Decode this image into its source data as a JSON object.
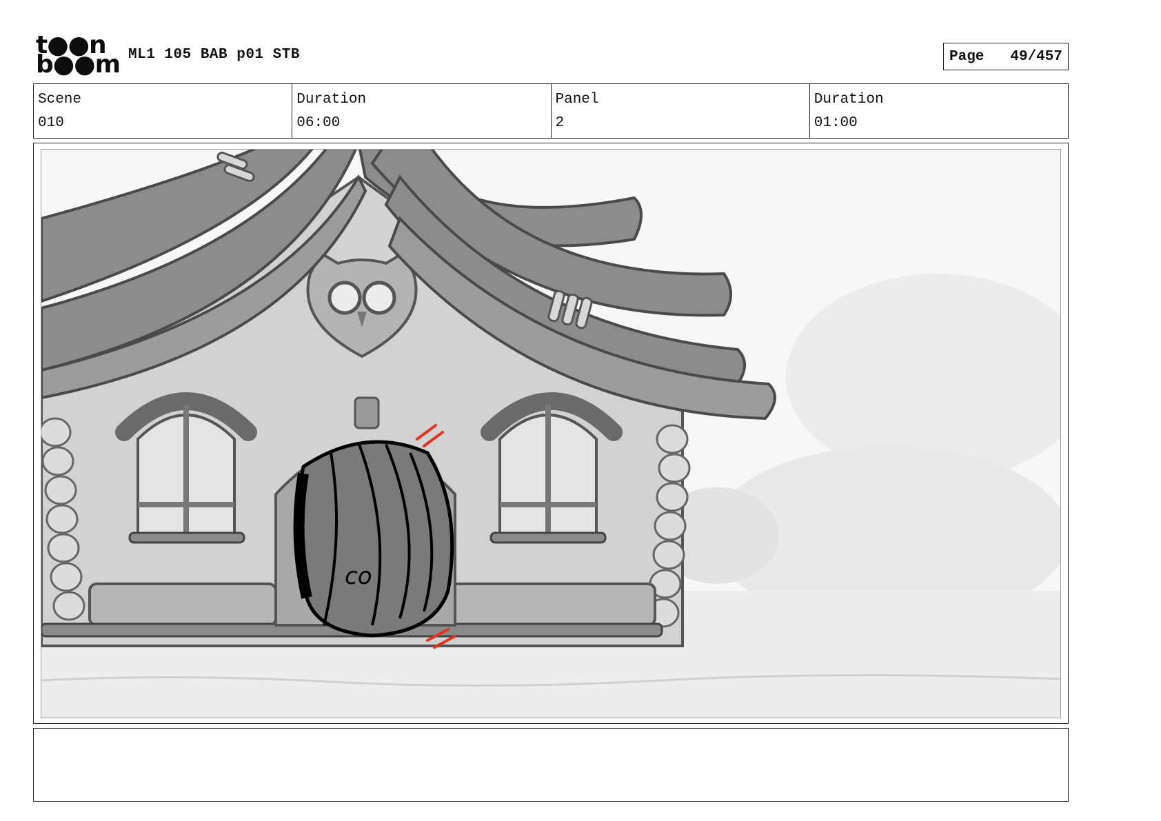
{
  "header": {
    "logo_top": "t●●n",
    "logo_bottom": "b●●m",
    "title": "ML1 105 BAB p01 STB",
    "page_label": "Page",
    "page_value": "49/457"
  },
  "info": {
    "scene_label": "Scene",
    "scene_value": "010",
    "scene_duration_label": "Duration",
    "scene_duration_value": "06:00",
    "panel_label": "Panel",
    "panel_value": "2",
    "panel_duration_label": "Duration",
    "panel_duration_value": "01:00"
  },
  "panel": {
    "door_mark": "co"
  },
  "notes": {
    "text": ""
  },
  "colors": {
    "border": "#222222",
    "sketch_dark": "#4a4a4a",
    "sketch_mid": "#8a8a8a",
    "sketch_light": "#c8c8c8",
    "accent_red": "#e0341c"
  }
}
